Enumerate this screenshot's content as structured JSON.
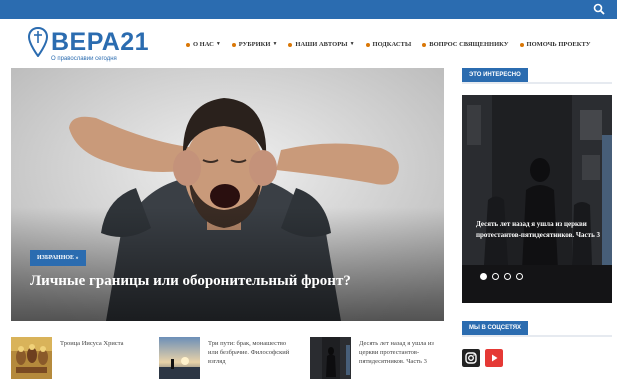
{
  "site": {
    "name": "ВЕРА21",
    "tagline": "О православии сегодня"
  },
  "nav": [
    {
      "label": "О НАС",
      "dropdown": true
    },
    {
      "label": "РУБРИКИ",
      "dropdown": true
    },
    {
      "label": "НАШИ АВТОРЫ",
      "dropdown": true
    },
    {
      "label": "ПОДКАСТЫ",
      "dropdown": false
    },
    {
      "label": "ВОПРОС СВЯЩЕННИКУ",
      "dropdown": false
    },
    {
      "label": "ПОМОЧЬ ПРОЕКТУ",
      "dropdown": false
    }
  ],
  "hero": {
    "badge": "ИЗБРАННОЕ »",
    "title": "Личные границы или оборонительный фронт?"
  },
  "sidebar": {
    "interesting_heading": "ЭТО ИНТЕРЕСНО",
    "featured_title": "Десять лет назад я ушла из церкви протестантов-пятидесятников. Часть 3",
    "slider_count": 4,
    "slider_active": 1,
    "social_heading": "МЫ В СОЦСЕТЯХ",
    "social_icons": [
      "instagram-icon",
      "youtube-icon"
    ]
  },
  "articles": [
    {
      "title": "Троица Иисуса Христа"
    },
    {
      "title": "Три пути: брак, монашество или безбрачие. Философский взгляд"
    },
    {
      "title": "Десять лет назад я ушла из церкви протестантов-пятидесятников. Часть 3"
    }
  ],
  "colors": {
    "brand": "#2b6cb0",
    "nav_dot": "#d97706",
    "youtube": "#e53935"
  }
}
